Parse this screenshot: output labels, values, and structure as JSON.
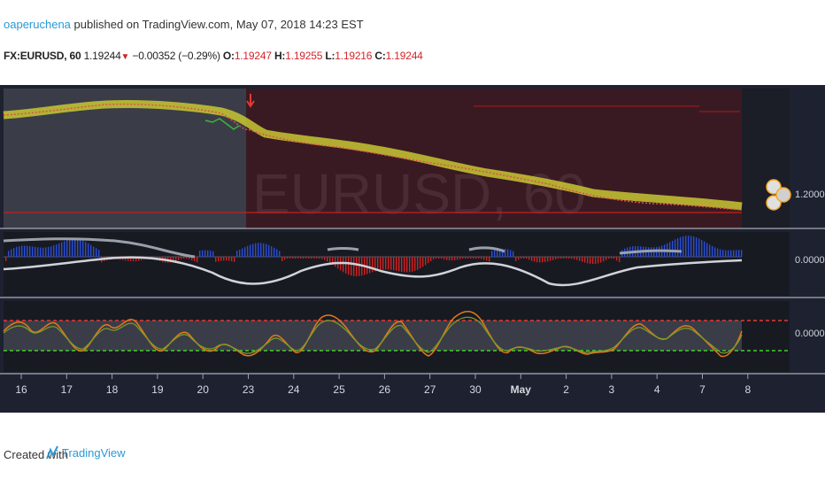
{
  "header": {
    "username": "oaperuchena",
    "published_text": "published on TradingView.com, May 07, 2018 14:23 EST",
    "symbol": "FX:EURUSD, 60",
    "last_price": "1.19244",
    "change": "−0.00352 (−0.29%)",
    "open_label": "O:",
    "open": "1.19247",
    "high_label": "H:",
    "high": "1.19255",
    "low_label": "L:",
    "low": "1.19216",
    "close_label": "C:",
    "close": "1.19244"
  },
  "chart": {
    "watermark": "EURUSD, 60",
    "price_label": "1.20000",
    "osc1_label": "0.0000",
    "osc2_label": "0.0000",
    "x_ticks": [
      "16",
      "17",
      "18",
      "19",
      "20",
      "23",
      "24",
      "25",
      "26",
      "27",
      "30",
      "May",
      "2",
      "3",
      "4",
      "7",
      "8"
    ],
    "colors": {
      "background": "#1e2230",
      "ma_band": "#c8c832",
      "hist_neg": "#d42020",
      "hist_pos": "#2a4dd8",
      "overbought": "#e53935",
      "oversold": "#43d02a"
    }
  },
  "footer": {
    "created_with": "Created with",
    "brand": "TradingView"
  }
}
